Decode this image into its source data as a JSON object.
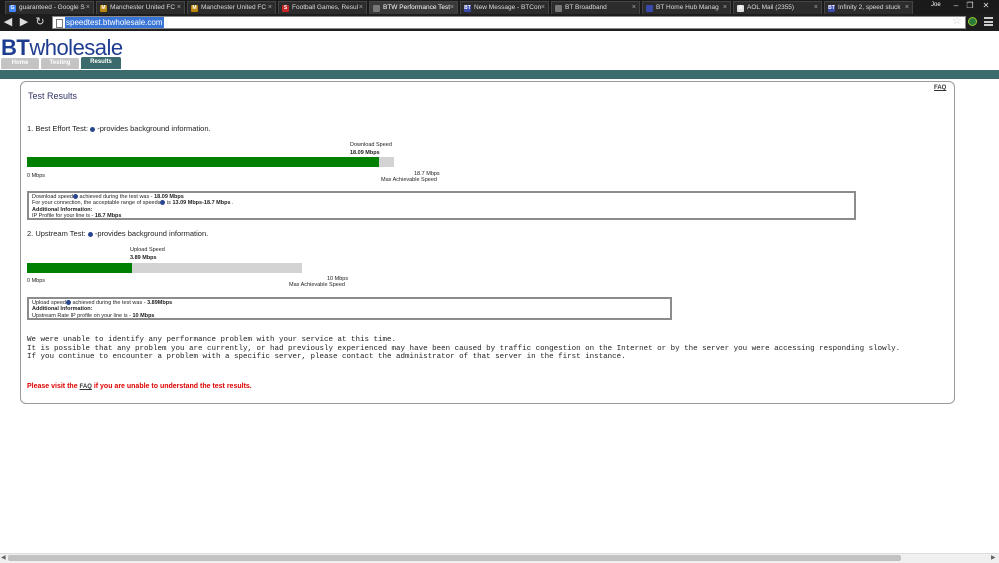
{
  "browser": {
    "tabs": [
      {
        "title": "guaranteed - Google S",
        "icon": "G",
        "color": "#4285f4"
      },
      {
        "title": "Manchester United FC",
        "icon": "M",
        "color": "#b8860b"
      },
      {
        "title": "Manchester United FC",
        "icon": "M",
        "color": "#b8860b"
      },
      {
        "title": "Football Games, Resul",
        "icon": "S",
        "color": "#c62828"
      },
      {
        "title": "BTW Performance Test",
        "icon": "",
        "color": "#777777"
      },
      {
        "title": "New Message - BTCon",
        "icon": "BT",
        "color": "#3949ab"
      },
      {
        "title": "BT Broadband",
        "icon": "",
        "color": "#777777"
      },
      {
        "title": "BT Home Hub Manag",
        "icon": "",
        "color": "#3949ab"
      },
      {
        "title": "AOL Mail (2355)",
        "icon": "A",
        "color": "#e0e0e0"
      },
      {
        "title": "Infinity 2, speed stuck",
        "icon": "BT",
        "color": "#3949ab"
      }
    ],
    "active_tab": 4,
    "user": "Joe",
    "url": "speedtest.btwholesale.com"
  },
  "site": {
    "logo_bold": "BT",
    "logo_rest": "wholesale",
    "nav": [
      "Home",
      "Testing",
      "Results"
    ],
    "active_nav": 2,
    "faq": "FAQ"
  },
  "results": {
    "title": "Test Results",
    "best_effort": {
      "heading": "1. Best Effort Test:",
      "heading_suffix": " -provides background information.",
      "speed_label": "Download Speed",
      "speed_value": "18.09 Mbps",
      "fill_fraction": 0.9588,
      "min_label": "0 Mbps",
      "max_value": "18.7 Mbps",
      "max_label": "Max Achievable Speed",
      "box": {
        "line1_pre": "Download speed",
        "line1_mid": " achieved during the test was - ",
        "line1_val": "18.09 Mbps",
        "line2_pre": "For your connection, the acceptable range of speeds",
        "line2_mid": " is ",
        "line2_val": "13.09 Mbps-18.7 Mbps",
        "line2_end": " .",
        "line3": "Additional Information:",
        "line4_pre": "IP Profile for your line is - ",
        "line4_val": "18.7 Mbps"
      }
    },
    "upstream": {
      "heading": "2. Upstream Test:",
      "heading_suffix": " -provides background information.",
      "speed_label": "Upload Speed",
      "speed_value": "3.89 Mbps",
      "fill_fraction": 0.38,
      "min_label": "0 Mbps",
      "max_value": "10 Mbps",
      "max_label": "Max Achievable Speed",
      "box": {
        "line1_pre": "Upload speed",
        "line1_mid": " achieved during the test was - ",
        "line1_val": "3.89Mbps",
        "line2": "Additional Information:",
        "line3_pre": "Upstream Rate IP profile on your line is - ",
        "line3_val": "10 Mbps"
      }
    },
    "paragraphs": [
      "We were unable to identify any performance problem with your service at this time.",
      "It is possible that any problem you are currently, or had previously experienced may have been caused by traffic congestion on the Internet or by the server you were accessing responding slowly.",
      "If you continue to encounter a problem with a specific server, please contact the administrator of that server in the first instance."
    ],
    "red_note_pre": "Please visit the ",
    "red_note_link": "FAQ",
    "red_note_post": " if you are unable to understand the test results."
  }
}
